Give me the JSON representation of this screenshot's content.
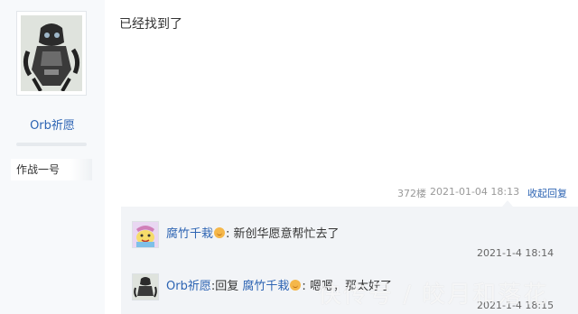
{
  "author": {
    "name": "Orb祈愿",
    "title": "作战一号"
  },
  "post": {
    "content": "已经找到了",
    "floor": "372楼",
    "datetime": "2021-01-04 18:13",
    "collapse_label": "收起回复"
  },
  "replies": [
    {
      "user": "腐竹千栽",
      "text": "新创华愿意帮忙去了",
      "time": "2021-1-4 18:14"
    },
    {
      "user": "Orb祈愿",
      "reply_word": "回复",
      "target": "腐竹千栽",
      "text": "嗯嗯，那太好了",
      "time": "2021-1-4 18:15"
    }
  ],
  "watermark": "快传号 / 皎月和落花",
  "icons": {
    "emoji": "smile-emoji-icon",
    "avatar": "avatar-image"
  },
  "colors": {
    "link": "#2d64b3",
    "reply_bg": "#f2f4f7",
    "sidebar_bg": "#f7f9fb"
  }
}
